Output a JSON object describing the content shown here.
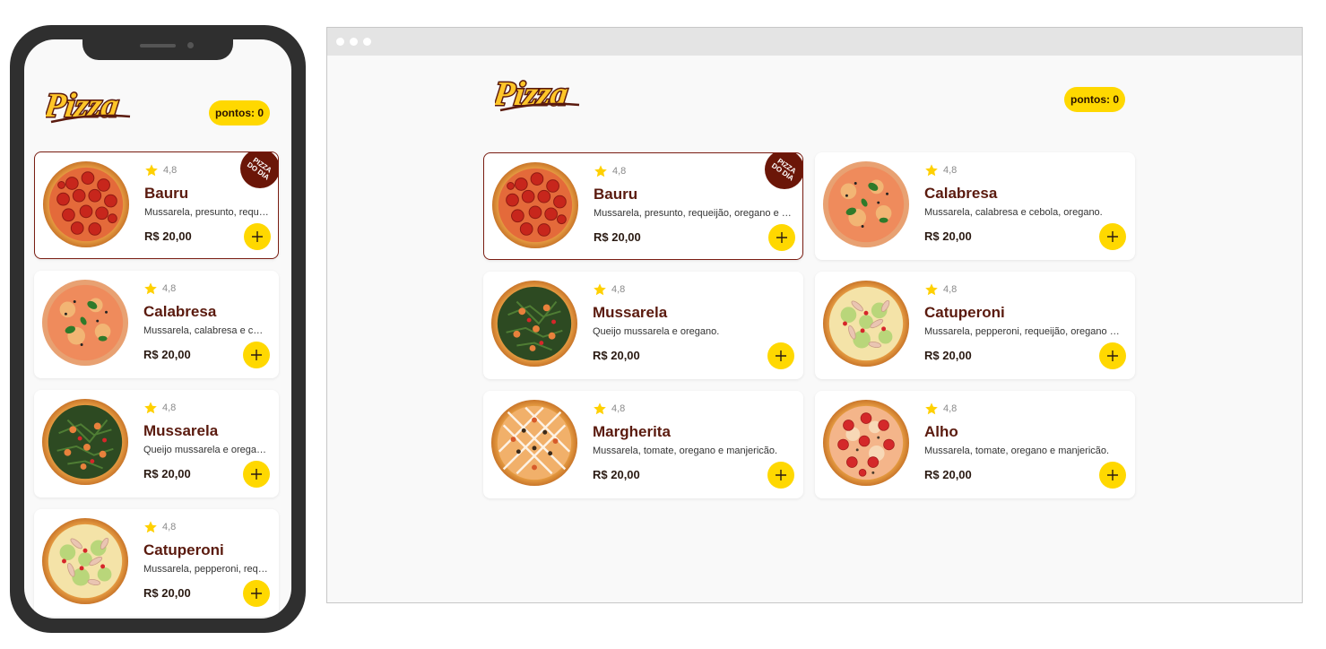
{
  "app": {
    "logo_text": "Pizza",
    "points_label": "pontos: 0"
  },
  "badge": {
    "label": "PIZZA DO DIA"
  },
  "phone": {
    "products": [
      {
        "name": "Bauru",
        "rating": "4,8",
        "desc": "Mussarela, presunto, requeijão, oregano e cebola.",
        "price": "R$ 20,00",
        "featured": true
      },
      {
        "name": "Calabresa",
        "rating": "4,8",
        "desc": "Mussarela, calabresa e cebola, oregano.",
        "price": "R$ 20,00"
      },
      {
        "name": "Mussarela",
        "rating": "4,8",
        "desc": "Queijo mussarela e oregano.",
        "price": "R$ 20,00"
      },
      {
        "name": "Catuperoni",
        "rating": "4,8",
        "desc": "Mussarela, pepperoni, requeijão, oregano e cebola.",
        "price": "R$ 20,00"
      }
    ]
  },
  "desktop": {
    "products": [
      {
        "name": "Bauru",
        "rating": "4,8",
        "desc": "Mussarela, presunto, requeijão, oregano e cebola.",
        "price": "R$ 20,00",
        "featured": true
      },
      {
        "name": "Calabresa",
        "rating": "4,8",
        "desc": "Mussarela, calabresa e cebola, oregano.",
        "price": "R$ 20,00"
      },
      {
        "name": "Mussarela",
        "rating": "4,8",
        "desc": "Queijo mussarela e oregano.",
        "price": "R$ 20,00"
      },
      {
        "name": "Catuperoni",
        "rating": "4,8",
        "desc": "Mussarela, pepperoni, requeijão, oregano e cebola.",
        "price": "R$ 20,00"
      },
      {
        "name": "Margherita",
        "rating": "4,8",
        "desc": "Mussarela, tomate, oregano e manjericão.",
        "price": "R$ 20,00"
      },
      {
        "name": "Alho",
        "rating": "4,8",
        "desc": "Mussarela, tomate, oregano e manjericão.",
        "price": "R$ 20,00"
      }
    ]
  },
  "colors": {
    "accent": "#ffd800",
    "brand": "#5a1a0e",
    "badge": "#6b1608"
  },
  "icons": {
    "rating": "star-icon",
    "add": "plus-icon",
    "product": "pizza-image"
  }
}
